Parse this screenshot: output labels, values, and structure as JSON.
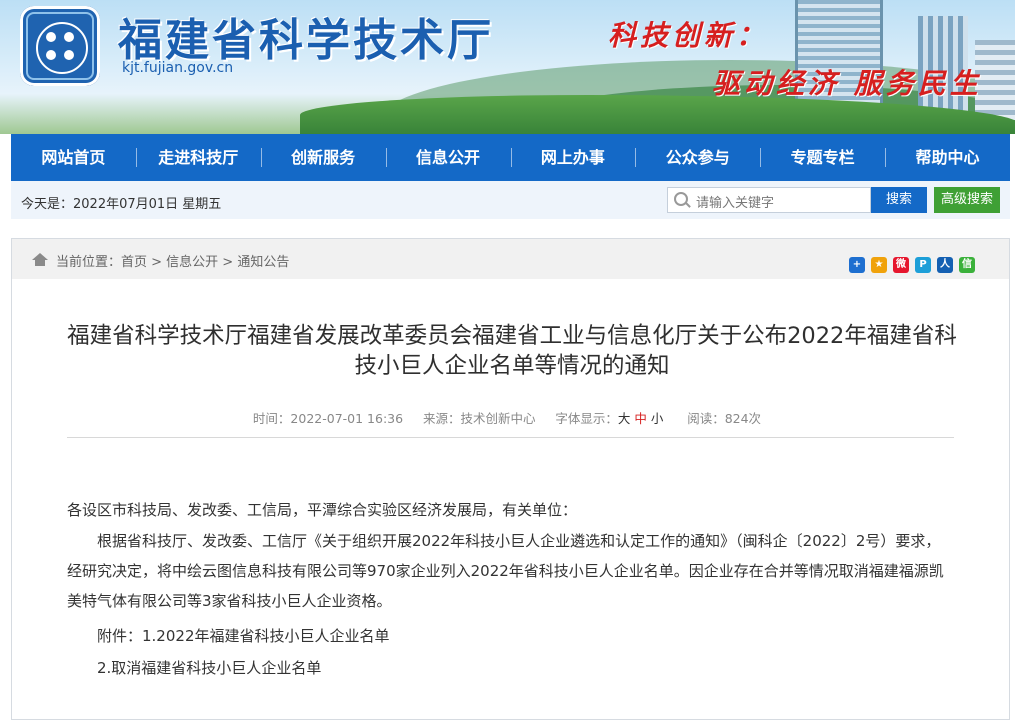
{
  "header": {
    "site_title": "福建省科学技术厅",
    "domain": "kjt.fujian.gov.cn",
    "slogan_line1": "科技创新：",
    "slogan_line2": "驱动经济 服务民生"
  },
  "nav": {
    "items": [
      "网站首页",
      "走进科技厅",
      "创新服务",
      "信息公开",
      "网上办事",
      "公众参与",
      "专题专栏",
      "帮助中心"
    ]
  },
  "datebar": {
    "date_text": "今天是：2022年07月01日  星期五",
    "search_placeholder": "请输入关键字",
    "search_label": "搜索",
    "advanced_search_label": "高级搜索"
  },
  "breadcrumb": {
    "text": "当前位置：首页 > 信息公开 > 通知公告"
  },
  "share_icons": [
    {
      "name": "share-plus-icon",
      "glyph": "+",
      "color": "#1e6fd0"
    },
    {
      "name": "share-qzone-icon",
      "glyph": "★",
      "color": "#f0a20b"
    },
    {
      "name": "share-weibo-icon",
      "glyph": "微",
      "color": "#e6162d"
    },
    {
      "name": "share-tencent-icon",
      "glyph": "P",
      "color": "#1d9fd8"
    },
    {
      "name": "share-renren-icon",
      "glyph": "人",
      "color": "#1460b2"
    },
    {
      "name": "share-wechat-icon",
      "glyph": "信",
      "color": "#3bb13b"
    }
  ],
  "article": {
    "title": "福建省科学技术厅福建省发展改革委员会福建省工业与信息化厅关于公布2022年福建省科技小巨人企业名单等情况的通知",
    "meta": {
      "time": "时间：2022-07-01 16:36",
      "source": "来源：技术创新中心",
      "font_label": "字体显示：",
      "size_large": "大",
      "size_medium": "中",
      "size_small": "小",
      "views": "阅读：824次"
    },
    "greeting": "各设区市科技局、发改委、工信局，平潭综合实验区经济发展局，有关单位：",
    "paragraph": "根据省科技厅、发改委、工信厅《关于组织开展2022年科技小巨人企业遴选和认定工作的通知》（闽科企〔2022〕2号）要求，经研究决定，将中绘云图信息科技有限公司等970家企业列入2022年省科技小巨人企业名单。因企业存在合并等情况取消福建福源凯美特气体有限公司等3家省科技小巨人企业资格。",
    "attachment1": "附件：1.2022年福建省科技小巨人企业名单",
    "attachment2": "2.取消福建省科技小巨人企业名单"
  }
}
